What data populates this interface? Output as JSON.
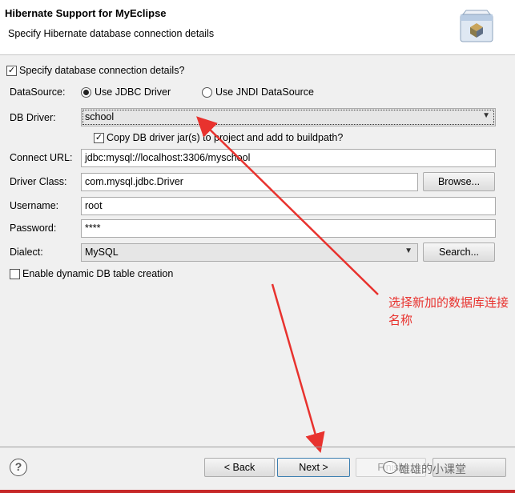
{
  "banner": {
    "title": "Hibernate Support for MyEclipse",
    "subtitle": "Specify Hibernate database connection details"
  },
  "form": {
    "specify_details": {
      "label": "Specify database connection details?",
      "checked": true
    },
    "datasource": {
      "label": "DataSource:",
      "options": [
        "Use JDBC Driver",
        "Use JNDI DataSource"
      ],
      "selected": "Use JDBC Driver"
    },
    "db_driver": {
      "label": "DB Driver:",
      "value": "school"
    },
    "copy_jars": {
      "label": "Copy DB driver jar(s) to project and add to buildpath?",
      "checked": true
    },
    "connect_url": {
      "label": "Connect URL:",
      "value": "jdbc:mysql://localhost:3306/myschool"
    },
    "driver_class": {
      "label": "Driver Class:",
      "value": "com.mysql.jdbc.Driver",
      "button": "Browse..."
    },
    "username": {
      "label": "Username:",
      "value": "root"
    },
    "password": {
      "label": "Password:",
      "value": "****"
    },
    "dialect": {
      "label": "Dialect:",
      "value": "MySQL",
      "button": "Search..."
    },
    "dynamic_table": {
      "label": "Enable dynamic DB table creation",
      "checked": false
    }
  },
  "annotation": {
    "text": "选择新加的数据库连接名称",
    "color": "#e8322e"
  },
  "footer": {
    "help": "?",
    "back": "< Back",
    "next": "Next >",
    "finish": "Finish",
    "watermark": "雄雄的小课堂"
  },
  "icons": {
    "wizard": "wizard-banner-icon",
    "help": "help-icon",
    "dropdown": "chevron-down-icon",
    "check": "check-icon"
  }
}
